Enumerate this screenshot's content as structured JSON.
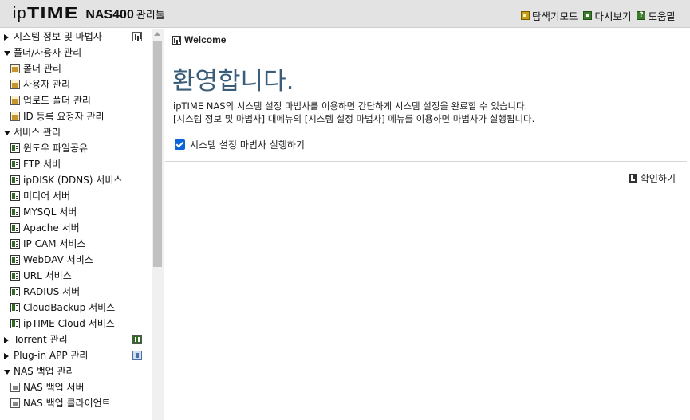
{
  "header": {
    "brand_ip": "ip",
    "brand_time": "TIME",
    "brand_model": "NAS400",
    "brand_suffix": "관리툴",
    "links": [
      {
        "label": "탐색기모드",
        "icon": "explorer-icon"
      },
      {
        "label": "다시보기",
        "icon": "refresh-icon"
      },
      {
        "label": "도움말",
        "icon": "help-icon"
      }
    ]
  },
  "sidebar": {
    "groups": [
      {
        "label": "시스템 정보 및 마법사",
        "expanded": false,
        "icon": "chart-icon"
      },
      {
        "label": "폴더/사용자 관리",
        "expanded": true,
        "items": [
          "폴더 관리",
          "사용자 관리",
          "업로드 폴더 관리",
          "ID 등록 요청자 관리"
        ]
      },
      {
        "label": "서비스 관리",
        "expanded": true,
        "items": [
          "윈도우 파일공유",
          "FTP 서버",
          "ipDISK (DDNS) 서비스",
          "미디어 서버",
          "MYSQL 서버",
          "Apache 서버",
          "IP CAM 서비스",
          "WebDAV 서비스",
          "URL 서비스",
          "RADIUS 서버",
          "CloudBackup 서비스",
          "ipTIME Cloud 서비스"
        ]
      },
      {
        "label": "Torrent 관리",
        "expanded": false,
        "icon": "torrent-icon"
      },
      {
        "label": "Plug-in APP 관리",
        "expanded": false,
        "icon": "plugin-icon"
      },
      {
        "label": "NAS 백업 관리",
        "expanded": true,
        "items": [
          "NAS 백업 서버",
          "NAS 백업 클라이언트"
        ]
      }
    ]
  },
  "main": {
    "tab_title": "Welcome",
    "heading": "환영합니다.",
    "desc_line1": "ipTIME NAS의 시스템 설정 마법사를 이용하면 간단하게 시스템 설정을 완료할 수 있습니다.",
    "desc_line2": "[시스템 정보 및 마법사] 대메뉴의 [시스템 설정 마법사] 메뉴를 이용하면 마법사가 실행됩니다.",
    "checkbox_label": "시스템 설정 마법사 실행하기",
    "checkbox_checked": true,
    "confirm_label": "확인하기"
  },
  "colors": {
    "heading": "#3a5d7a",
    "header_bg": "#e3e3e3",
    "checkbox": "#0a66d8"
  }
}
